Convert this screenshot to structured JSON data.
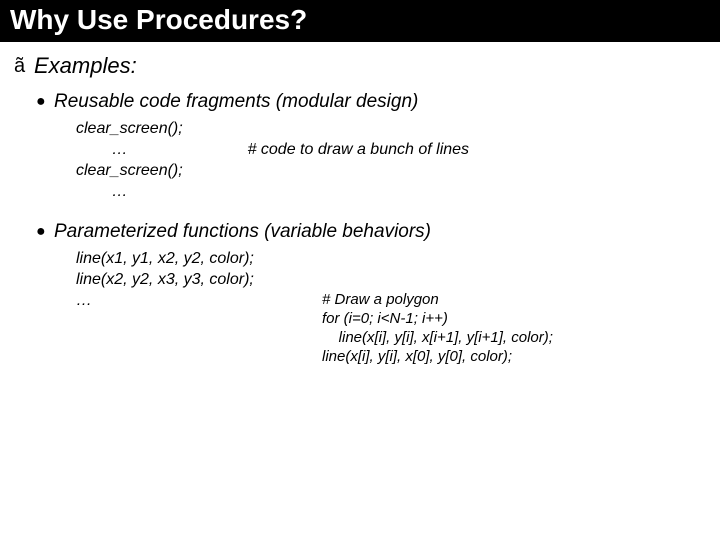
{
  "title": "Why Use Procedures?",
  "bullet0_glyph": "ã",
  "bullet1_glyph": "●",
  "examples_label": "Examples:",
  "item1": {
    "heading": "Reusable code fragments (modular design)",
    "code1": "clear_screen();",
    "code2": "        …",
    "comment": "# code to draw a bunch of lines",
    "code3": "clear_screen();",
    "code4": "        …"
  },
  "item2": {
    "heading": "Parameterized functions (variable behaviors)",
    "code1": "line(x1, y1, x2, y2, color);",
    "code2": "line(x2, y2, x3, y3, color);",
    "code3": "…",
    "block": {
      "l1": "# Draw a polygon",
      "l2": "for (i=0; i<N-1; i++)",
      "l3": "    line(x[i], y[i], x[i+1], y[i+1], color);",
      "l4": "line(x[i], y[i], x[0], y[0], color);"
    }
  }
}
